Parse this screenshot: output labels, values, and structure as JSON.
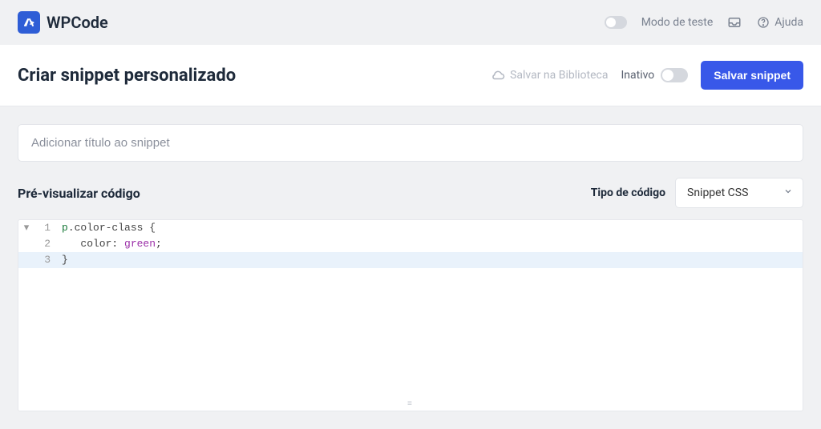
{
  "topbar": {
    "brand": "WPCode",
    "test_mode_label": "Modo de teste",
    "help_label": "Ajuda"
  },
  "subheader": {
    "title": "Criar snippet personalizado",
    "cloud_save_label": "Salvar na Biblioteca",
    "status_label": "Inativo",
    "save_button_label": "Salvar snippet"
  },
  "main": {
    "title_placeholder": "Adicionar título ao snippet",
    "preview_label": "Pré-visualizar código",
    "code_type_label": "Tipo de código",
    "code_type_value": "Snippet CSS"
  },
  "code": {
    "lines": [
      {
        "num": 1,
        "fold": "▾",
        "tokens": [
          [
            "tag",
            "p"
          ],
          [
            "class",
            ".color-class "
          ],
          [
            "brace",
            "{"
          ]
        ]
      },
      {
        "num": 2,
        "fold": "",
        "tokens": [
          [
            "plain",
            "   "
          ],
          [
            "prop",
            "color"
          ],
          [
            "plain",
            ": "
          ],
          [
            "val",
            "green"
          ],
          [
            "plain",
            ";"
          ]
        ]
      },
      {
        "num": 3,
        "fold": "",
        "active": true,
        "tokens": [
          [
            "brace",
            "}"
          ]
        ]
      }
    ]
  }
}
